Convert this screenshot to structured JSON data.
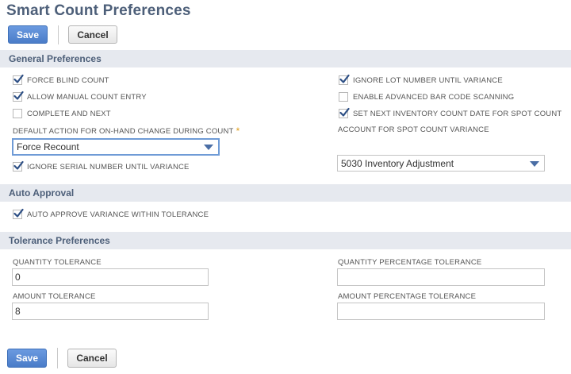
{
  "page": {
    "title": "Smart Count Preferences"
  },
  "toolbar": {
    "save_label": "Save",
    "cancel_label": "Cancel"
  },
  "general": {
    "heading": "General Preferences",
    "force_blind_count": {
      "label": "FORCE BLIND COUNT",
      "checked": true
    },
    "allow_manual_count_entry": {
      "label": "ALLOW MANUAL COUNT ENTRY",
      "checked": true
    },
    "complete_and_next": {
      "label": "COMPLETE AND NEXT",
      "checked": false
    },
    "default_action": {
      "label": "DEFAULT ACTION FOR ON-HAND CHANGE DURING COUNT",
      "required_mark": "*",
      "value": "Force Recount"
    },
    "ignore_serial": {
      "label": "IGNORE SERIAL NUMBER UNTIL VARIANCE",
      "checked": true
    },
    "ignore_lot": {
      "label": "IGNORE LOT NUMBER UNTIL VARIANCE",
      "checked": true
    },
    "enable_barcode": {
      "label": "ENABLE ADVANCED BAR CODE SCANNING",
      "checked": false
    },
    "set_next_count_date": {
      "label": "SET NEXT INVENTORY COUNT DATE FOR SPOT COUNT",
      "checked": true
    },
    "spot_count_account": {
      "label": "ACCOUNT FOR SPOT COUNT VARIANCE",
      "value": "5030 Inventory Adjustment"
    }
  },
  "auto_approval": {
    "heading": "Auto Approval",
    "auto_approve": {
      "label": "AUTO APPROVE VARIANCE WITHIN TOLERANCE",
      "checked": true
    }
  },
  "tolerance": {
    "heading": "Tolerance Preferences",
    "quantity_tolerance": {
      "label": "QUANTITY TOLERANCE",
      "value": "0"
    },
    "amount_tolerance": {
      "label": "AMOUNT TOLERANCE",
      "value": "8"
    },
    "quantity_percentage_tolerance": {
      "label": "QUANTITY PERCENTAGE TOLERANCE",
      "value": ""
    },
    "amount_percentage_tolerance": {
      "label": "AMOUNT PERCENTAGE TOLERANCE",
      "value": ""
    }
  },
  "icons": {
    "checkmark": "checkmark-icon",
    "dropdown": "chevron-down-icon"
  },
  "colors": {
    "primary_button": "#4a7cc8",
    "section_band": "#e6e9ef",
    "heading_text": "#4d5f79",
    "check": "#2d4f85",
    "required": "#e0a020"
  }
}
